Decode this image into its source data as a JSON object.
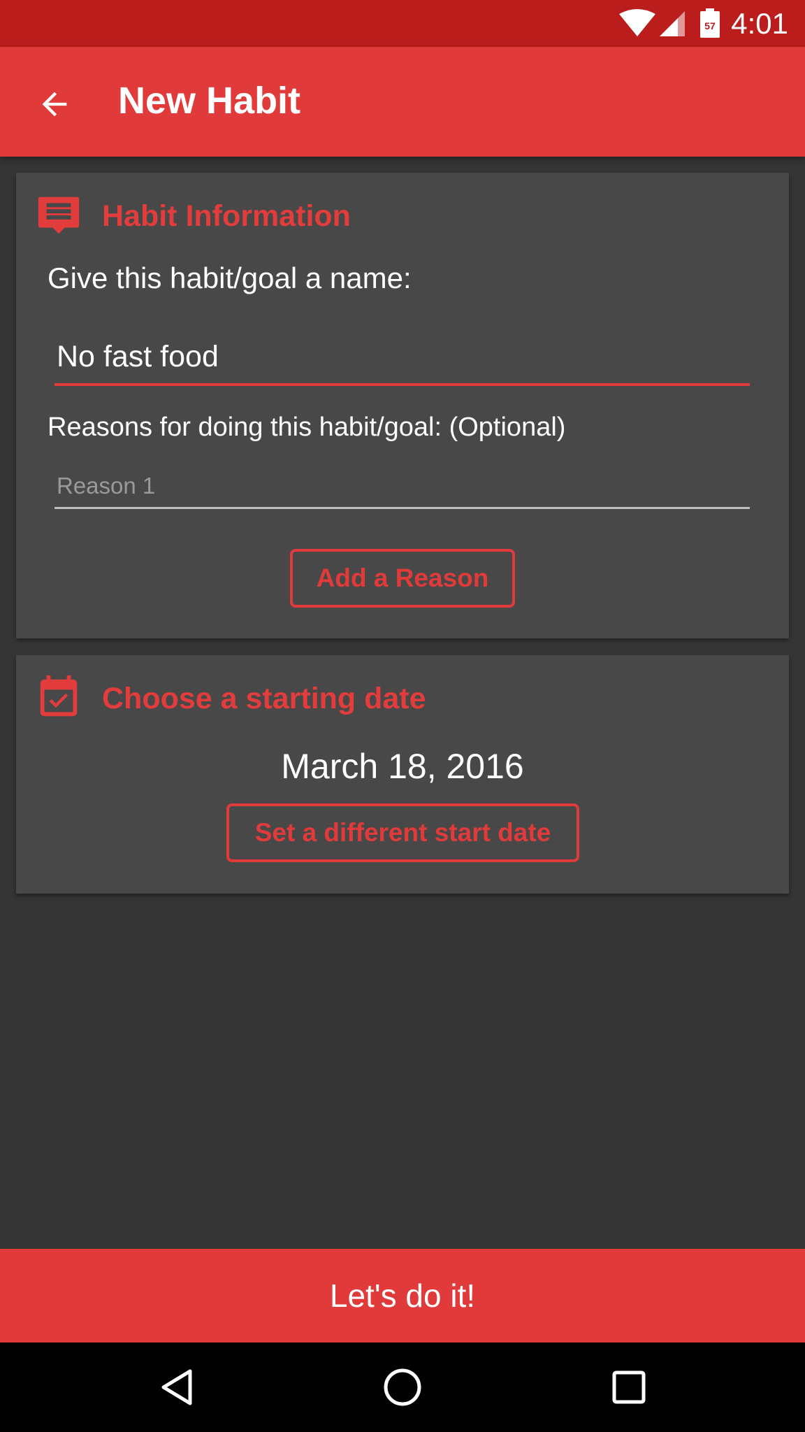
{
  "status_bar": {
    "time": "4:01",
    "battery_level": "57",
    "icons": [
      "wifi-icon",
      "cell-signal-icon",
      "battery-icon"
    ]
  },
  "app_bar": {
    "title": "New Habit",
    "back_icon": "arrow-back-icon"
  },
  "habit_info": {
    "title": "Habit Information",
    "icon": "comment-icon",
    "name_label": "Give this habit/goal a name:",
    "name_value": "No fast food",
    "reasons_label": "Reasons for doing this habit/goal: (Optional)",
    "reason_placeholder": "Reason 1",
    "add_reason_label": "Add a Reason"
  },
  "start_date": {
    "title": "Choose a starting date",
    "icon": "calendar-check-icon",
    "date_value": "March 18, 2016",
    "change_label": "Set a different start date"
  },
  "footer": {
    "submit_label": "Let's do it!"
  },
  "nav_bar": {
    "icons": [
      "back-triangle-icon",
      "home-circle-icon",
      "recents-square-icon"
    ]
  },
  "colors": {
    "accent": "#e03a3a",
    "status_bar": "#bb1c1c",
    "card": "#484848",
    "background": "#353535"
  }
}
